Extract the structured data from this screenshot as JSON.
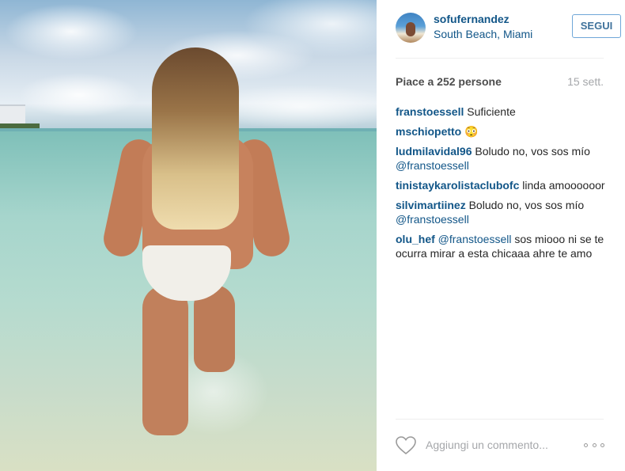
{
  "post": {
    "image_alt": "",
    "user": {
      "username": "sofufernandez",
      "location": "South Beach, Miami"
    },
    "follow_label": "SEGUI",
    "likes_text": "Piace a 252 persone",
    "date": "15 sett.",
    "comments": [
      {
        "author": "franstoessell",
        "mention": "",
        "text": " Suficiente"
      },
      {
        "author": "mschiopetto",
        "mention": "",
        "text": " 😳"
      },
      {
        "author": "ludmilavidal96",
        "mention": "",
        "text": " Boludo no, vos sos mío",
        "trail_mention": "@franstoessell"
      },
      {
        "author": "tinistaykarolistaclubofc",
        "mention": "",
        "text": " linda amoooooor"
      },
      {
        "author": "silvimartiinez",
        "mention": "",
        "text": " Boludo no, vos sos mío",
        "trail_mention": "@franstoessell"
      },
      {
        "author": "olu_hef",
        "mention": " @franstoessell",
        "text": " sos miooo ni se te ocurra mirar a esta chicaaa ahre te amo"
      }
    ],
    "comment_placeholder": "Aggiungi un commento...",
    "icons": {
      "like": "heart-icon",
      "more": "more-options-icon"
    },
    "colors": {
      "link": "#125688",
      "follow_border": "#6fa7d8",
      "muted": "#a5a7aa"
    }
  }
}
